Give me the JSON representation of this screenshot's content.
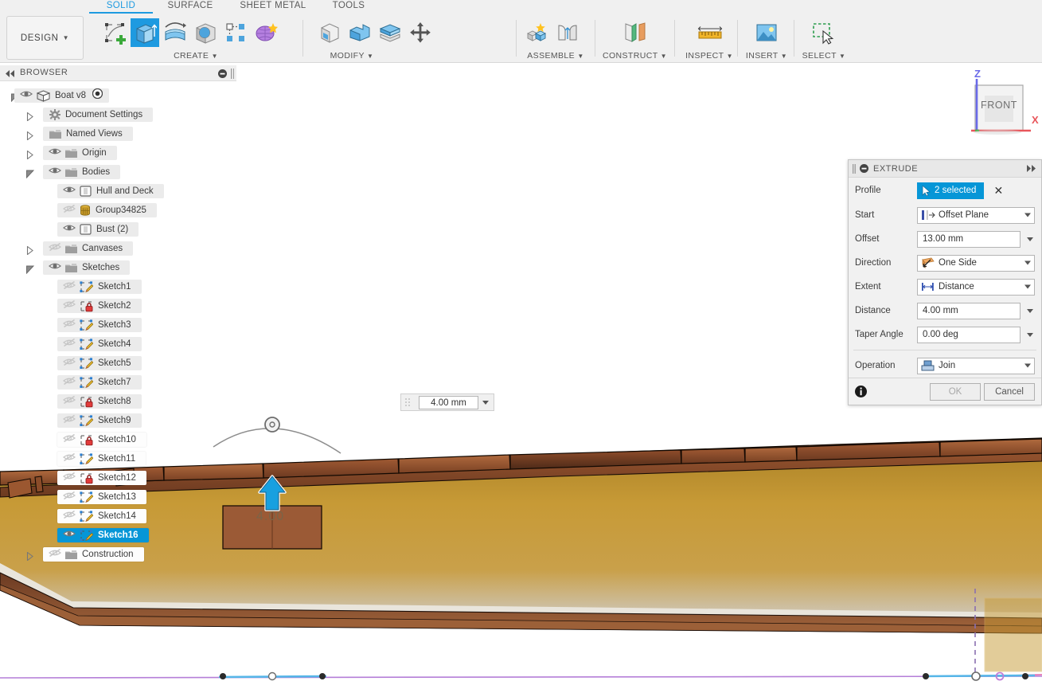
{
  "app": {
    "workspace_label": "DESIGN",
    "tabs": [
      {
        "label": "SOLID",
        "active": true
      },
      {
        "label": "SURFACE",
        "active": false
      },
      {
        "label": "SHEET METAL",
        "active": false
      },
      {
        "label": "TOOLS",
        "active": false
      }
    ],
    "ribbon_groups": [
      {
        "label": "CREATE",
        "icons": [
          "create-sketch-icon",
          "extrude-icon",
          "revolve-icon",
          "sweep-icon",
          "pattern-icon",
          "form-icon"
        ]
      },
      {
        "label": "MODIFY",
        "icons": [
          "press-pull-icon",
          "fillet-icon",
          "shell-icon",
          "move-copy-icon"
        ]
      },
      {
        "label": "ASSEMBLE",
        "icons": [
          "new-component-icon",
          "joint-icon"
        ]
      },
      {
        "label": "CONSTRUCT",
        "icons": [
          "offset-plane-icon"
        ]
      },
      {
        "label": "INSPECT",
        "icons": [
          "measure-icon"
        ]
      },
      {
        "label": "INSERT",
        "icons": [
          "insert-canvas-icon"
        ]
      },
      {
        "label": "SELECT",
        "icons": [
          "select-window-icon"
        ]
      }
    ]
  },
  "browser": {
    "title": "BROWSER",
    "collapse_icon": "collapse-left-icon",
    "minus_icon": "minus-circle-icon",
    "grip_icon": "grip-icon",
    "items": [
      {
        "label": "Boat v8",
        "indent": 0,
        "arrow": "down",
        "eye": "visible",
        "icon": "component-icon",
        "kind": "root",
        "activated": true,
        "opaque": false
      },
      {
        "label": "Document Settings",
        "indent": 1,
        "arrow": "right",
        "eye": "none",
        "icon": "gear-icon",
        "kind": "settings",
        "opaque": false
      },
      {
        "label": "Named Views",
        "indent": 1,
        "arrow": "right",
        "eye": "none",
        "icon": "folder-icon",
        "kind": "folder",
        "opaque": false
      },
      {
        "label": "Origin",
        "indent": 1,
        "arrow": "right",
        "eye": "visible",
        "icon": "folder-icon",
        "kind": "folder",
        "opaque": false
      },
      {
        "label": "Bodies",
        "indent": 1,
        "arrow": "down",
        "eye": "visible",
        "icon": "folder-icon",
        "kind": "folder",
        "opaque": false
      },
      {
        "label": "Hull and Deck",
        "indent": 2,
        "arrow": "none",
        "eye": "visible",
        "icon": "body-icon",
        "kind": "body",
        "opaque": false
      },
      {
        "label": "Group34825",
        "indent": 2,
        "arrow": "none",
        "eye": "hidden",
        "icon": "mesh-body-icon",
        "kind": "mesh",
        "opaque": false
      },
      {
        "label": "Bust (2)",
        "indent": 2,
        "arrow": "none",
        "eye": "visible",
        "icon": "body-icon",
        "kind": "body",
        "opaque": false
      },
      {
        "label": "Canvases",
        "indent": 1,
        "arrow": "right",
        "eye": "hidden",
        "icon": "folder-icon",
        "kind": "folder",
        "opaque": false
      },
      {
        "label": "Sketches",
        "indent": 1,
        "arrow": "down",
        "eye": "visible",
        "icon": "folder-icon",
        "kind": "folder",
        "opaque": false
      },
      {
        "label": "Sketch1",
        "indent": 2,
        "arrow": "none",
        "eye": "hidden",
        "icon": "sketch-icon",
        "kind": "sketch",
        "opaque": false
      },
      {
        "label": "Sketch2",
        "indent": 2,
        "arrow": "none",
        "eye": "hidden",
        "icon": "sketch-locked-icon",
        "kind": "sketch-locked",
        "opaque": false
      },
      {
        "label": "Sketch3",
        "indent": 2,
        "arrow": "none",
        "eye": "hidden",
        "icon": "sketch-icon",
        "kind": "sketch",
        "opaque": false
      },
      {
        "label": "Sketch4",
        "indent": 2,
        "arrow": "none",
        "eye": "hidden",
        "icon": "sketch-icon",
        "kind": "sketch",
        "opaque": false
      },
      {
        "label": "Sketch5",
        "indent": 2,
        "arrow": "none",
        "eye": "hidden",
        "icon": "sketch-icon",
        "kind": "sketch",
        "opaque": false
      },
      {
        "label": "Sketch7",
        "indent": 2,
        "arrow": "none",
        "eye": "hidden",
        "icon": "sketch-icon",
        "kind": "sketch",
        "opaque": false
      },
      {
        "label": "Sketch8",
        "indent": 2,
        "arrow": "none",
        "eye": "hidden",
        "icon": "sketch-locked-icon",
        "kind": "sketch-locked",
        "opaque": false
      },
      {
        "label": "Sketch9",
        "indent": 2,
        "arrow": "none",
        "eye": "hidden",
        "icon": "sketch-icon",
        "kind": "sketch",
        "opaque": false
      },
      {
        "label": "Sketch10",
        "indent": 2,
        "arrow": "none",
        "eye": "hidden",
        "icon": "sketch-locked-icon",
        "kind": "sketch-locked",
        "opaque": true
      },
      {
        "label": "Sketch11",
        "indent": 2,
        "arrow": "none",
        "eye": "hidden",
        "icon": "sketch-icon",
        "kind": "sketch",
        "opaque": true
      },
      {
        "label": "Sketch12",
        "indent": 2,
        "arrow": "none",
        "eye": "hidden",
        "icon": "sketch-locked-icon",
        "kind": "sketch-locked",
        "opaque": true
      },
      {
        "label": "Sketch13",
        "indent": 2,
        "arrow": "none",
        "eye": "hidden",
        "icon": "sketch-icon",
        "kind": "sketch",
        "opaque": true
      },
      {
        "label": "Sketch14",
        "indent": 2,
        "arrow": "none",
        "eye": "hidden",
        "icon": "sketch-icon",
        "kind": "sketch",
        "opaque": true
      },
      {
        "label": "Sketch16",
        "indent": 2,
        "arrow": "none",
        "eye": "visible",
        "icon": "sketch-icon",
        "kind": "sketch",
        "selected": true,
        "opaque": true
      },
      {
        "label": "Construction",
        "indent": 1,
        "arrow": "right",
        "eye": "hidden",
        "icon": "folder-icon",
        "kind": "folder",
        "opaque": true
      }
    ]
  },
  "extrude_dialog": {
    "title": "EXTRUDE",
    "minimize_icon": "minus-circle-icon",
    "expand_icon": "expand-right-icon",
    "rows": [
      {
        "label": "Profile",
        "type": "select",
        "value": "2 selected",
        "icon": "cursor-arrow-icon",
        "clear_icon": "close-icon"
      },
      {
        "label": "Start",
        "type": "combo",
        "value": "Offset Plane",
        "icon": "offset-plane-icon"
      },
      {
        "label": "Offset",
        "type": "text",
        "value": "13.00 mm"
      },
      {
        "label": "Direction",
        "type": "combo",
        "value": "One Side",
        "icon": "one-side-icon"
      },
      {
        "label": "Extent",
        "type": "combo",
        "value": "Distance",
        "icon": "distance-icon"
      },
      {
        "label": "Distance",
        "type": "text",
        "value": "4.00 mm"
      },
      {
        "label": "Taper Angle",
        "type": "text",
        "value": "0.00 deg"
      },
      {
        "label": "Operation",
        "type": "combo",
        "value": "Join",
        "icon": "join-icon"
      }
    ],
    "info_icon": "info-icon",
    "ok_label": "OK",
    "ok_disabled": true,
    "cancel_label": "Cancel"
  },
  "canvas": {
    "dimension_input": {
      "value": "4.00 mm",
      "dropdown_icon": "chevron-down-icon",
      "grip_icon": "grip-dots-icon"
    },
    "extrude_preview_label": "4.00",
    "manipulator_icon": "extrude-arrow-up-icon",
    "rotate_handle_icon": "rotate-handle-icon",
    "view_cube": {
      "face_label": "FRONT",
      "axis_z_label": "Z",
      "axis_x_label": "X",
      "axis_z_color": "#6a6ae8",
      "axis_x_color": "#e8565b"
    },
    "model_name": "boat-hull-3d-model",
    "colors": {
      "hull_body": "#c59a3a",
      "hull_plank_dark": "#5b3220",
      "hull_plank_mid": "#8a4b2e",
      "hull_stripe": "#e8e4da",
      "sketch_line": "#56b6e8",
      "construction_line": "#8a6fb0",
      "accent": "#0696d7"
    }
  }
}
